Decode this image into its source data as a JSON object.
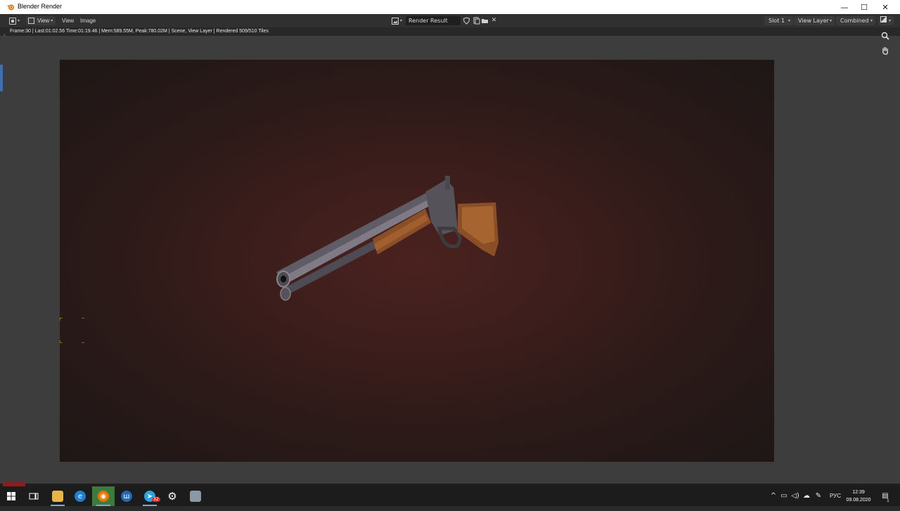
{
  "window": {
    "title": "Blender Render",
    "minimize_glyph": "—",
    "maximize_glyph": "☐",
    "close_glyph": "✕"
  },
  "header": {
    "view_menu_label": "View",
    "menus": [
      "View",
      "Image"
    ],
    "image_name": "Render Result",
    "slot": "Slot 1",
    "view_layer": "View Layer",
    "pass": "Combined"
  },
  "status": {
    "text": "Frame:30 | Last:01:02.56 Time:01:19.46 | Mem:589.55M, Peak:780.02M | Scene, View Layer | Rendered 509/510 Tiles"
  },
  "tools": {
    "zoom_icon": "magnifier-icon",
    "pan_icon": "hand-icon"
  },
  "taskbar": {
    "lang": "РУС",
    "time": "12:39",
    "date": "09.08.2020",
    "telegram_badge": "32",
    "notification_badge": "1"
  },
  "colors": {
    "accent": "#3f6fae",
    "render_bg": "#3a1d1b",
    "wood": "#8a4f26",
    "metal": "#6d6a72"
  }
}
